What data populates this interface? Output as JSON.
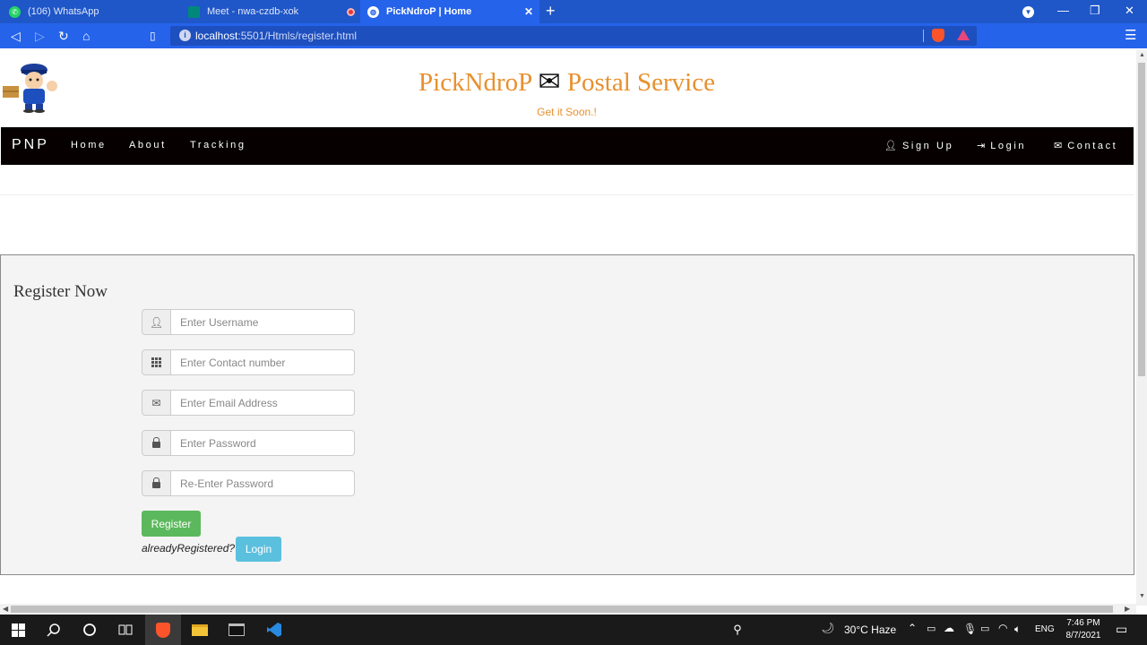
{
  "browser": {
    "tabs": [
      {
        "title": "(106) WhatsApp",
        "active": false
      },
      {
        "title": "Meet - nwa-czdb-xok",
        "active": false
      },
      {
        "title": "PickNdroP | Home",
        "active": true
      }
    ],
    "url_host": "localhost",
    "url_rest": ":5501/Htmls/register.html"
  },
  "site": {
    "title_left": "PickNdroP",
    "title_icon": "✉",
    "title_right": "Postal Service",
    "tagline": "Get it Soon.!"
  },
  "nav": {
    "brand": "PNP",
    "left_links": [
      "Home",
      "About",
      "Tracking"
    ],
    "right_links": [
      {
        "icon": "user-icon",
        "label": "Sign Up"
      },
      {
        "icon": "login-icon",
        "label": "Login"
      },
      {
        "icon": "envelope-icon",
        "label": "Contact"
      }
    ]
  },
  "form": {
    "title": "Register Now",
    "fields": [
      {
        "icon": "user-icon",
        "placeholder": "Enter Username"
      },
      {
        "icon": "grid-icon",
        "placeholder": "Enter Contact number"
      },
      {
        "icon": "envelope-icon",
        "placeholder": "Enter Email Address"
      },
      {
        "icon": "lock-icon",
        "placeholder": "Enter Password"
      },
      {
        "icon": "lock-icon",
        "placeholder": "Re-Enter Password"
      }
    ],
    "register_label": "Register",
    "already_text": "alreadyRegistered?",
    "login_label": "Login"
  },
  "taskbar": {
    "weather": "30°C  Haze",
    "lang": "ENG",
    "time": "7:46 PM",
    "date": "8/7/2021"
  }
}
